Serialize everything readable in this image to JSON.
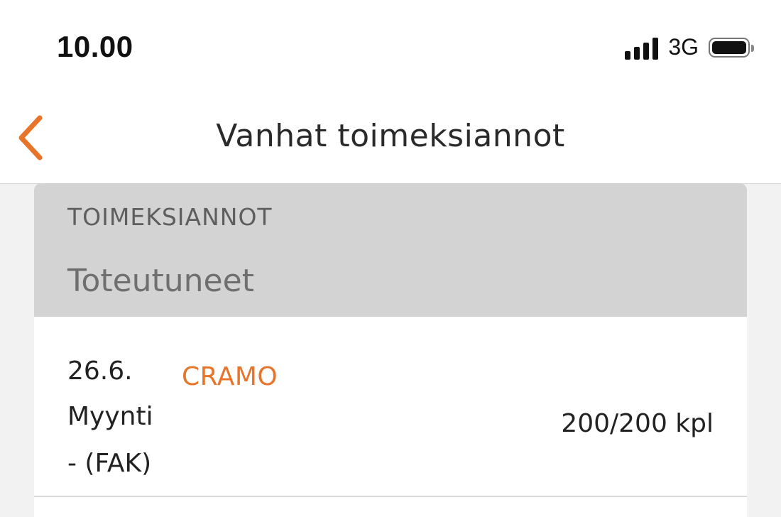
{
  "status_bar": {
    "time": "10.00",
    "network": "3G",
    "icons": [
      "signal-icon",
      "battery-icon"
    ]
  },
  "nav": {
    "title": "Vanhat toimeksiannot",
    "back_icon": "chevron-left-icon"
  },
  "colors": {
    "accent": "#e8742a",
    "header_bg": "#d3d3d3",
    "page_bg": "#f2f2f2"
  },
  "list": {
    "section_label": "TOIMEKSIANNOT",
    "subsection_label": "Toteutuneet",
    "orders": [
      {
        "date": "26.6.",
        "company": "CRAMO",
        "type": "Myynti",
        "type_detail": "- (FAK)",
        "quantity": "200/200 kpl"
      }
    ]
  }
}
